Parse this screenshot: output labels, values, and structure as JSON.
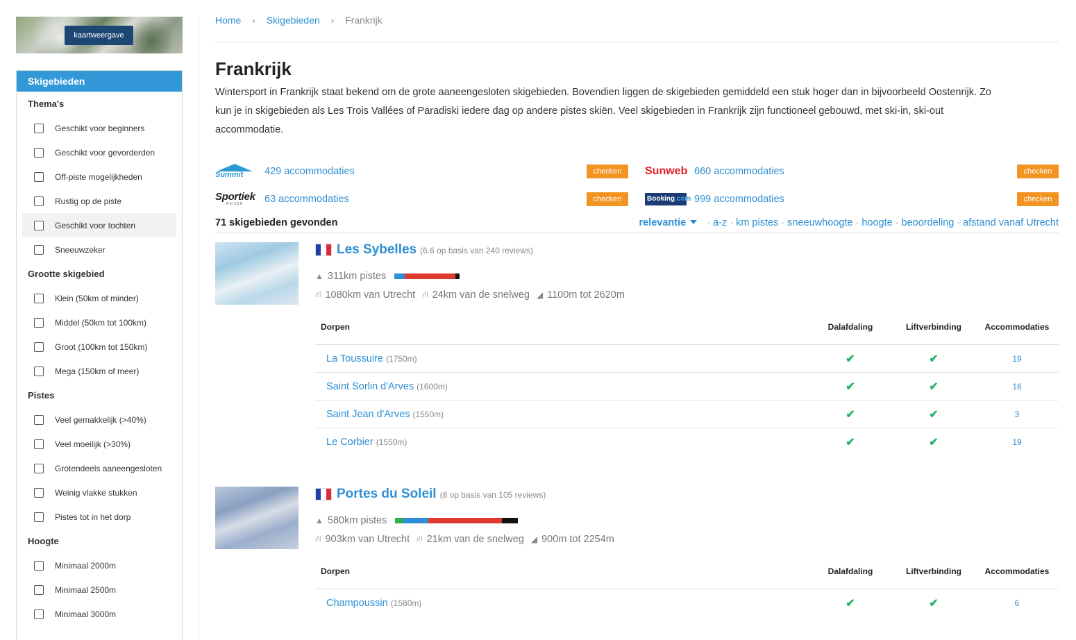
{
  "sidebar": {
    "map_button": "kaartweergave",
    "panel_title": "Skigebieden",
    "groups": [
      {
        "title": "Thema's",
        "items": [
          "Geschikt voor beginners",
          "Geschikt voor gevorderden",
          "Off-piste mogelijkheden",
          "Rustig op de piste",
          "Geschikt voor tochten",
          "Sneeuwzeker"
        ]
      },
      {
        "title": "Grootte skigebied",
        "items": [
          "Klein (50km of minder)",
          "Middel (50km tot 100km)",
          "Groot (100km tot 150km)",
          "Mega (150km of meer)"
        ]
      },
      {
        "title": "Pistes",
        "items": [
          "Veel gemakkelijk (>40%)",
          "Veel moeilijk (>30%)",
          "Grotendeels aaneengesloten",
          "Weinig vlakke stukken",
          "Pistes tot in het dorp"
        ]
      },
      {
        "title": "Hoogte",
        "items": [
          "Minimaal 2000m",
          "Minimaal 2500m",
          "Minimaal 3000m"
        ]
      }
    ]
  },
  "breadcrumb": {
    "home": "Home",
    "level2": "Skigebieden",
    "current": "Frankrijk",
    "separator": "›"
  },
  "page": {
    "title": "Frankrijk",
    "intro": "Wintersport in Frankrijk staat bekend om de grote aaneengesloten skigebieden. Bovendien liggen de skigebieden gemiddeld een stuk hoger dan in bijvoorbeeld Oostenrijk. Zo kun je in skigebieden als Les Trois Vallées of Paradiski iedere dag op andere pistes skiën. Veel skigebieden in Frankrijk zijn functioneel gebouwd, met ski-in, ski-out accommodatie."
  },
  "partners": [
    {
      "name": "Summit",
      "count": "429 accommodaties",
      "button": "checken"
    },
    {
      "name": "Sunweb",
      "count": "660 accommodaties",
      "button": "checken"
    },
    {
      "name": "Sportiek",
      "sub": "REIZEN",
      "count": "63 accommodaties",
      "button": "checken"
    },
    {
      "name": "Booking",
      "suffix": ".com",
      "count": "999 accommodaties",
      "button": "checken"
    }
  ],
  "results": {
    "count": "71 skigebieden gevonden",
    "sort_active": "relevantie",
    "sort_options": [
      "a-z",
      "km pistes",
      "sneeuwhoogte",
      "hoogte",
      "beoordeling",
      "afstand vanaf Utrecht"
    ],
    "sort_separator": "·"
  },
  "table_headers": {
    "villages": "Dorpen",
    "descent": "Dalafdaling",
    "lift": "Liftverbinding",
    "accommodations": "Accommodaties"
  },
  "check_symbol": "✔",
  "colors": {
    "accent": "#2e8fd4",
    "panel": "#3398d8",
    "orange": "#f39322",
    "check": "#25b36a",
    "green_piste": "#2bb34a",
    "blue_piste": "#2e8fd4",
    "red_piste": "#e03a2f",
    "black_piste": "#111111"
  },
  "areas": [
    {
      "name": "Les Sybelles",
      "reviews": "(6.6 op basis van 240 reviews)",
      "pistes": "311km pistes",
      "piste_split": {
        "green": 0,
        "blue": 16,
        "red": 77,
        "black": 7
      },
      "distance": "1080km van Utrecht",
      "highway": "24km van de snelweg",
      "altitude": "1100m tot 2620m",
      "villages": [
        {
          "name": "La Toussuire",
          "alt": "(1750m)",
          "acc": "19"
        },
        {
          "name": "Saint Sorlin d'Arves",
          "alt": "(1600m)",
          "acc": "16"
        },
        {
          "name": "Saint Jean d'Arves",
          "alt": "(1550m)",
          "acc": "3"
        },
        {
          "name": "Le Corbier",
          "alt": "(1550m)",
          "acc": "19"
        }
      ]
    },
    {
      "name": "Portes du Soleil",
      "reviews": "(8 op basis van 105 reviews)",
      "pistes": "580km pistes",
      "piste_split": {
        "green": 6,
        "blue": 21,
        "red": 60,
        "black": 13
      },
      "distance": "903km van Utrecht",
      "highway": "21km van de snelweg",
      "altitude": "900m tot 2254m",
      "villages": [
        {
          "name": "Champoussin",
          "alt": "(1580m)",
          "acc": "6"
        }
      ]
    }
  ]
}
